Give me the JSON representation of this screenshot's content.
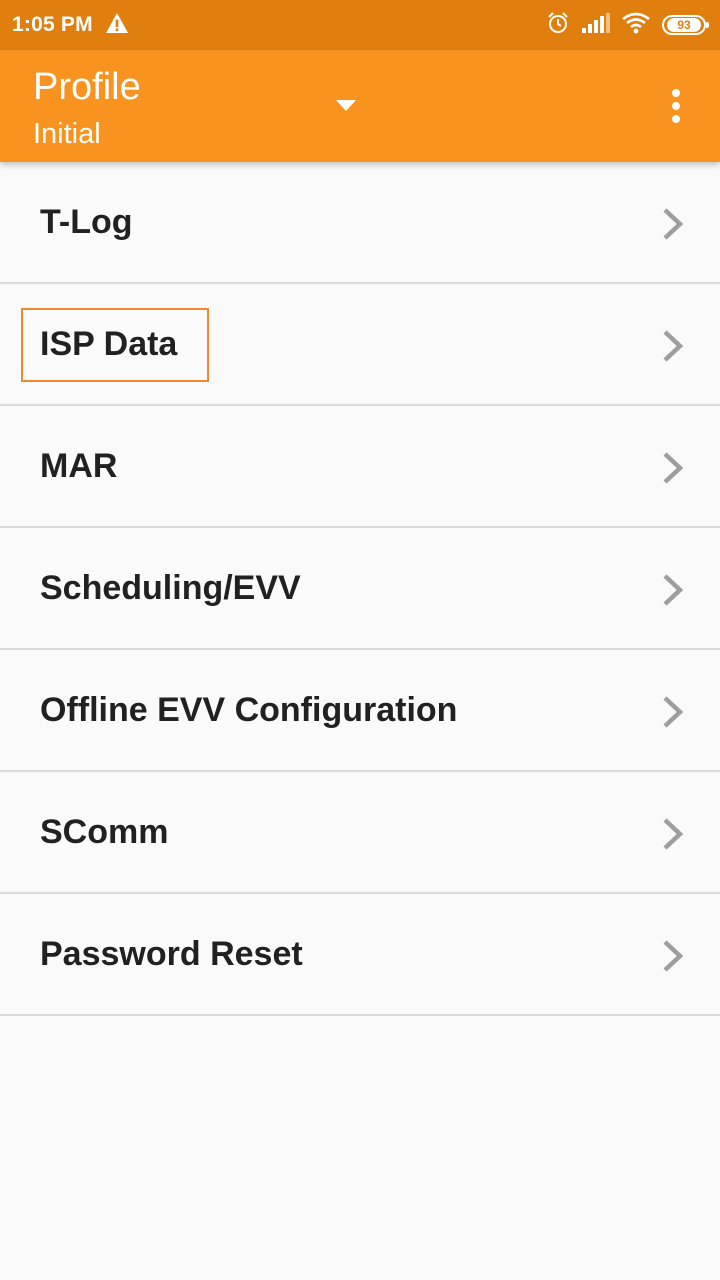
{
  "status_bar": {
    "time": "1:05 PM",
    "battery": "93",
    "icons": [
      "warning-icon",
      "alarm-icon",
      "signal-icon",
      "wifi-icon",
      "battery-icon"
    ]
  },
  "app_bar": {
    "title": "Profile",
    "subtitle": "Initial",
    "icons": [
      "dropdown-arrow-icon",
      "overflow-menu-icon"
    ]
  },
  "menu": {
    "items": [
      {
        "label": "T-Log"
      },
      {
        "label": "ISP Data"
      },
      {
        "label": "MAR"
      },
      {
        "label": "Scheduling/EVV"
      },
      {
        "label": "Offline EVV Configuration"
      },
      {
        "label": "SComm"
      },
      {
        "label": "Password Reset"
      }
    ]
  },
  "colors": {
    "status_bar": "#e07f0e",
    "app_bar": "#f7931e",
    "highlight": "#ef8a2e",
    "chevron": "#9e9e9e",
    "background": "#fafafa"
  }
}
